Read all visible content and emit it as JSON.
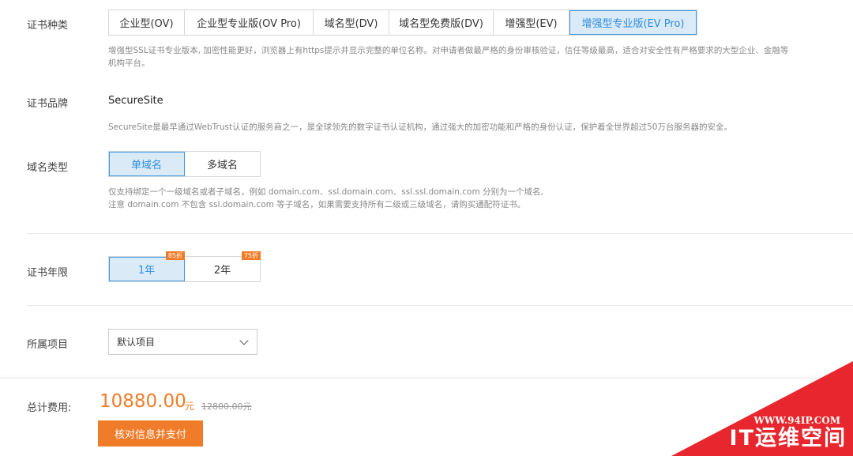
{
  "cert_type": {
    "label": "证书种类",
    "options": [
      "企业型(OV)",
      "企业型专业版(OV Pro)",
      "域名型(DV)",
      "域名型免费版(DV)",
      "增强型(EV)",
      "增强型专业版(EV Pro)"
    ],
    "selected": "增强型专业版(EV Pro)",
    "desc_line1": "增强型SSL证书专业版本, 加密性能更好，浏览器上有https提示并显示完整的单位名称。对申请者做最严格的身份审核验证，信任等级最高，适合对安全性有严格要求的大型企业、金融等",
    "desc_line2": "机构平台。"
  },
  "cert_brand": {
    "label": "证书品牌",
    "value": "SecureSite",
    "desc": "SecureSite是最早通过WebTrust认证的服务商之一，是全球领先的数字证书认证机构，通过强大的加密功能和严格的身份认证，保护着全世界超过50万台服务器的安全。"
  },
  "domain_type": {
    "label": "域名类型",
    "options": [
      "单域名",
      "多域名"
    ],
    "selected": "单域名",
    "desc_line1": "仅支持绑定一个一级域名或者子域名，例如 domain.com、ssl.domain.com、ssl.ssl.domain.com 分别为一个域名,",
    "desc_line2": "注意 domain.com 不包含 ssl.domain.com 等子域名，如果需要支持所有二级或三级域名，请购买通配符证书。"
  },
  "cert_years": {
    "label": "证书年限",
    "options": [
      {
        "label": "1年",
        "badge": "85折"
      },
      {
        "label": "2年",
        "badge": "75折"
      }
    ],
    "selected": "1年"
  },
  "project": {
    "label": "所属项目",
    "value": "默认项目"
  },
  "footer": {
    "total_label": "总计费用:",
    "price": "10880.00",
    "unit": "元",
    "old_price": "12800.00元",
    "pay_button": "核对信息并支付"
  },
  "watermark": {
    "line1": "WWW.94IP.COM",
    "line2": "IT运维空间"
  },
  "colors": {
    "accent": "#2d8ee0",
    "orange": "#f07c2a",
    "watermark_red": "#e8262d"
  }
}
